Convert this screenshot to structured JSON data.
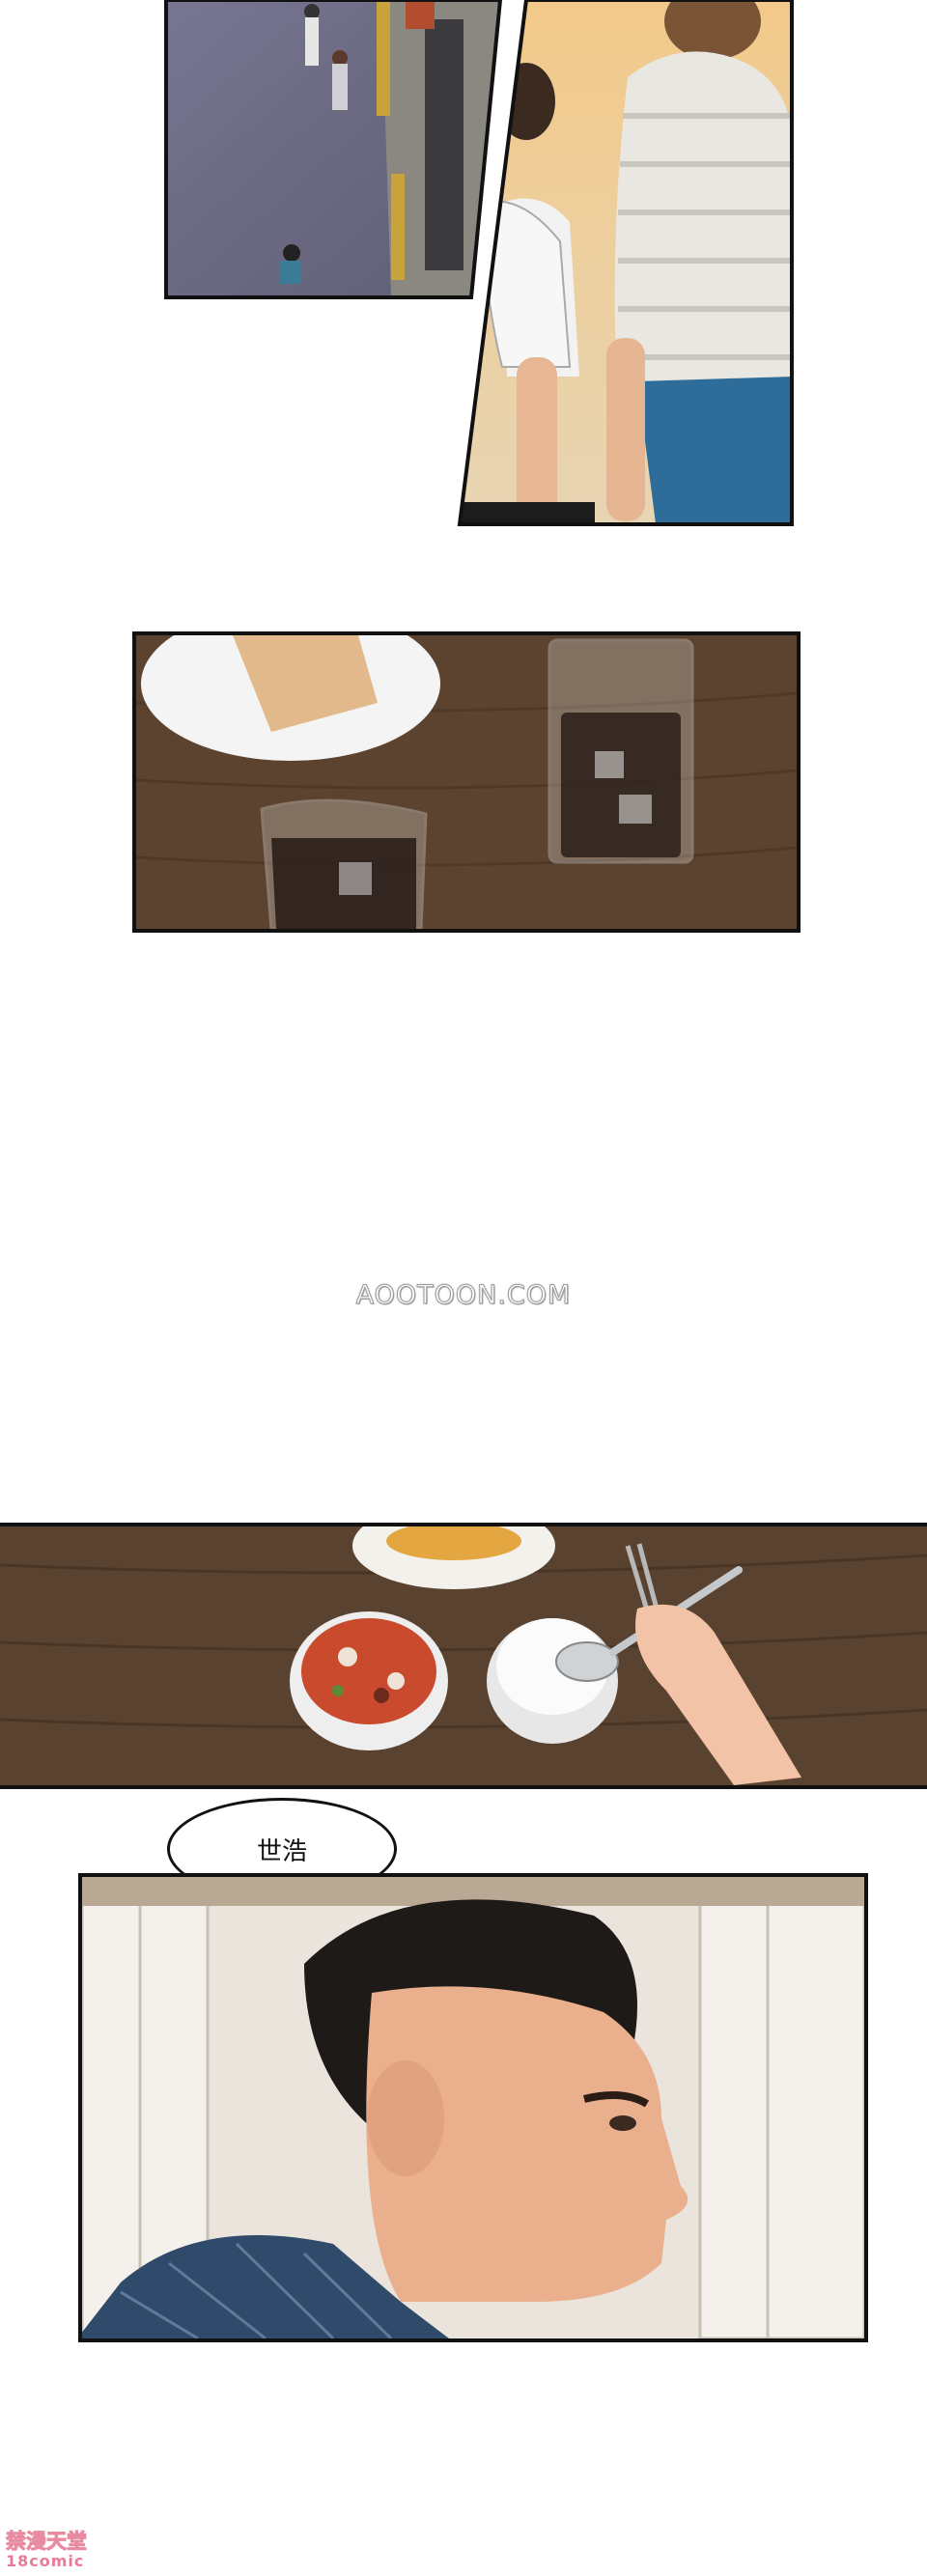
{
  "speech_bubble": {
    "text": "世浩"
  },
  "watermark": {
    "text": "AOOTOON.COM"
  },
  "corner_logo": {
    "line1": "禁漫天堂",
    "line2": "18comic"
  },
  "colors": {
    "panel_border": "#111111",
    "table_wood": "#5c4330",
    "pavement": "#6e6d84",
    "hoodie_blue": "#2e6d9a"
  },
  "panels": [
    {
      "name": "street-overhead-panel"
    },
    {
      "name": "couple-walking-panel"
    },
    {
      "name": "table-drinks-panel"
    },
    {
      "name": "table-meal-panel"
    },
    {
      "name": "man-profile-panel"
    }
  ]
}
